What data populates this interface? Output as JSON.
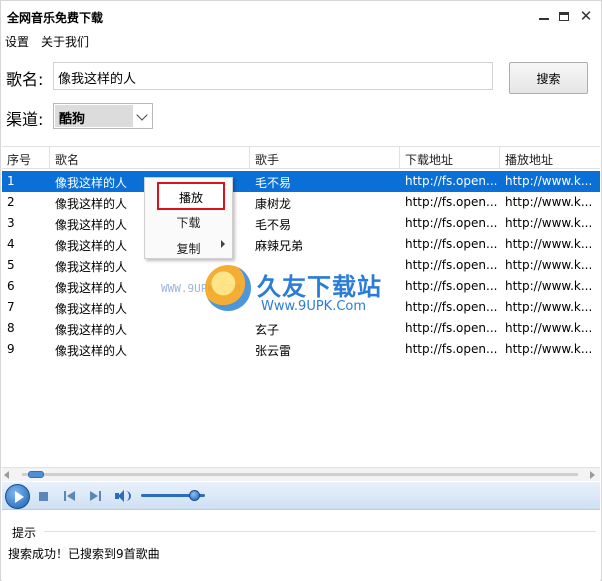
{
  "window": {
    "title": "全网音乐免费下载",
    "controls": {
      "minimize": "minimize-icon",
      "maximize": "maximize-icon",
      "close": "close-icon",
      "close_glyph": "✕"
    }
  },
  "menu": {
    "settings": "设置",
    "about": "关于我们"
  },
  "search": {
    "song_label": "歌名:",
    "song_value": "像我这样的人",
    "button_label": "搜索",
    "channel_label": "渠道:",
    "channel_value": "酷狗"
  },
  "table": {
    "headers": [
      "序号",
      "歌名",
      "歌手",
      "下载地址",
      "播放地址"
    ],
    "rows": [
      {
        "index": "1",
        "song": "像我这样的人",
        "artist": "毛不易",
        "download": "http://fs.open...",
        "play": "http://www.k..."
      },
      {
        "index": "2",
        "song": "像我这样的人",
        "artist": "康树龙",
        "download": "http://fs.open...",
        "play": "http://www.k..."
      },
      {
        "index": "3",
        "song": "像我这样的人",
        "artist": "毛不易",
        "download": "http://fs.open...",
        "play": "http://www.k..."
      },
      {
        "index": "4",
        "song": "像我这样的人",
        "artist": "麻辣兄弟",
        "download": "http://fs.open...",
        "play": "http://www.k..."
      },
      {
        "index": "5",
        "song": "像我这样的人",
        "artist": "",
        "download": "http://fs.open...",
        "play": "http://www.k..."
      },
      {
        "index": "6",
        "song": "像我这样的人",
        "artist": "",
        "download": "http://fs.open...",
        "play": "http://www.k..."
      },
      {
        "index": "7",
        "song": "像我这样的人",
        "artist": "",
        "download": "http://fs.open...",
        "play": "http://www.k..."
      },
      {
        "index": "8",
        "song": "像我这样的人",
        "artist": "玄子",
        "download": "http://fs.open...",
        "play": "http://www.k..."
      },
      {
        "index": "9",
        "song": "像我这样的人",
        "artist": "张云雷",
        "download": "http://fs.open...",
        "play": "http://www.k..."
      }
    ],
    "selected_row": 0
  },
  "context_menu": {
    "play": "播放",
    "download": "下载",
    "copy": "复制"
  },
  "watermark": {
    "title": "久友下载站",
    "url": "Www.9UPK.Com",
    "url_faint": "WWW.9UPK.COM"
  },
  "player": {
    "volume_level": 0.85
  },
  "tips": {
    "header": "提示",
    "message": "搜索成功！已搜索到9首歌曲"
  },
  "colors": {
    "selected_row": "#0a6fd6",
    "highlight_border": "#d8141b",
    "watermark": "#2a7cd6"
  }
}
